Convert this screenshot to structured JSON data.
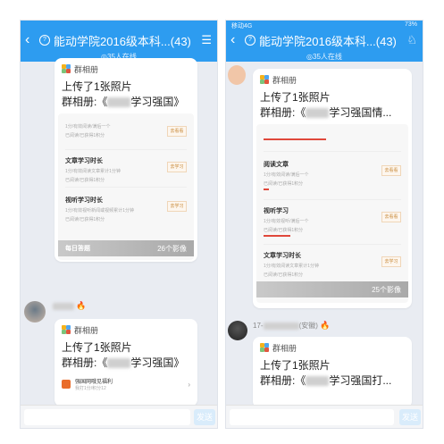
{
  "left": {
    "status_left": "",
    "header": {
      "back_icon": "back-arrow-icon",
      "title": "能动学院2016级本科...(43)",
      "subtitle": "◎35人在线",
      "menu_icon": "menu-icon"
    },
    "card1": {
      "album_label": "群相册",
      "line1": "上传了1张照片",
      "line2_prefix": "群相册:《",
      "line2_suffix": "学习强国》",
      "rows": [
        {
          "title": "",
          "sub": "1分/有效阅读/满后一个",
          "sub2": "已阅读/已获得1积分",
          "button": "去看看"
        },
        {
          "title": "文章学习时长",
          "sub": "1分/有效阅读文章累计1分钟",
          "sub2": "已阅读/已获得1积分",
          "button": "去学习"
        },
        {
          "title": "视听学习时长",
          "sub": "1分/有效视听新闻或视频累计1分钟",
          "sub2": "已阅读/已获得1积分",
          "button": "去学习"
        }
      ],
      "footer_label": "每日答题",
      "footer_count": "26个影像"
    },
    "user_fire": "🔥",
    "card2": {
      "album_label": "群相册",
      "line1": "上传了1张照片",
      "line2_prefix": "群相册:《",
      "line2_suffix": "学习强国》",
      "preview_title": "强国网哦见福利",
      "preview_sub": "我打1分/积分12"
    },
    "send_label": "发送"
  },
  "right": {
    "status_left": "移动4G",
    "status_right": "73%",
    "header": {
      "back_icon": "back-arrow-icon",
      "title": "能动学院2016级本科...(43)",
      "subtitle": "◎35人在线",
      "menu_icon": "menu-icon"
    },
    "card1": {
      "album_label": "群相册",
      "line1": "上传了1张照片",
      "line2_prefix": "群相册:《",
      "line2_suffix": "学习强国情...",
      "rows": [
        {
          "title": "阅读文章",
          "sub": "1分/有效阅读/满后一个",
          "sub2": "已阅读/已获得1积分",
          "button": "去看看"
        },
        {
          "title": "视听学习",
          "sub": "1分/有效视听/满后一个",
          "sub2": "已阅读/已获得1积分",
          "button": "去看看"
        },
        {
          "title": "文章学习时长",
          "sub": "1分/有效阅读文章累计1分钟",
          "sub2": "已阅读/已获得1积分",
          "button": "去学习"
        }
      ],
      "footer_count": "25个影像"
    },
    "user_name": "17-",
    "user_loc": "(安徽)",
    "user_fire": "🔥",
    "card2": {
      "album_label": "群相册",
      "line1": "上传了1张照片",
      "line2_prefix": "群相册:《",
      "line2_suffix": "学习强国打..."
    },
    "send_label": "发送"
  }
}
